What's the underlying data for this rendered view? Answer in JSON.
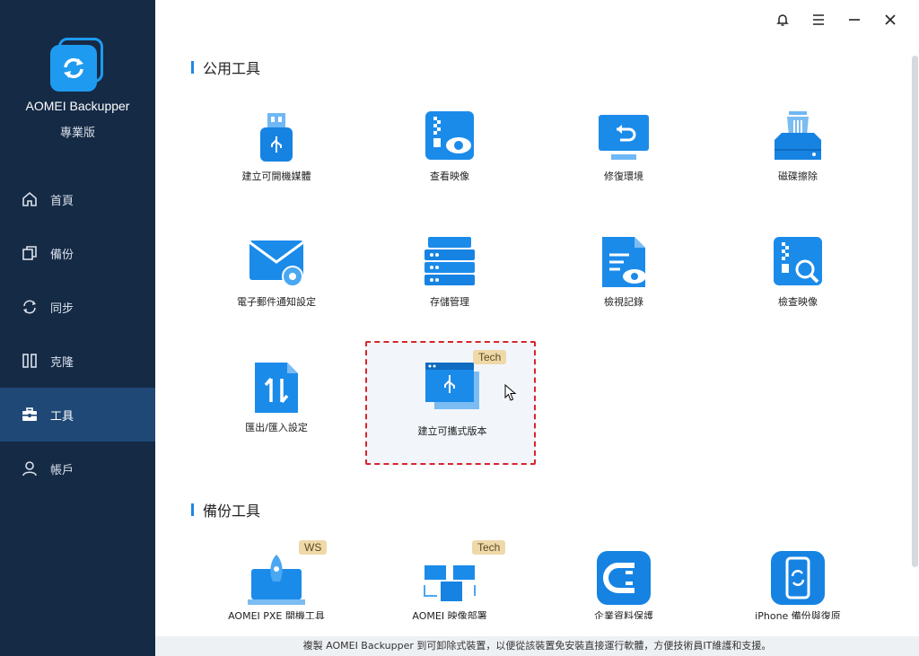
{
  "app": {
    "name": "AOMEI Backupper",
    "edition": "專業版"
  },
  "sidebar": {
    "items": [
      {
        "label": "首頁",
        "icon": "home-icon",
        "active": false
      },
      {
        "label": "備份",
        "icon": "copy-icon",
        "active": false
      },
      {
        "label": "同步",
        "icon": "sync-icon",
        "active": false
      },
      {
        "label": "克隆",
        "icon": "clone-icon",
        "active": false
      },
      {
        "label": "工具",
        "icon": "toolbox-icon",
        "active": true
      },
      {
        "label": "帳戶",
        "icon": "user-icon",
        "active": false
      }
    ]
  },
  "sections": {
    "utilities": {
      "title": "公用工具",
      "tools": [
        {
          "label": "建立可開機媒體",
          "icon": "usb-drive-icon"
        },
        {
          "label": "查看映像",
          "icon": "view-image-icon"
        },
        {
          "label": "修復環境",
          "icon": "recovery-environment-icon"
        },
        {
          "label": "磁碟擦除",
          "icon": "disk-wipe-icon"
        },
        {
          "label": "電子郵件通知設定",
          "icon": "email-settings-icon"
        },
        {
          "label": "存儲管理",
          "icon": "storage-management-icon"
        },
        {
          "label": "檢視記錄",
          "icon": "view-logs-icon"
        },
        {
          "label": "檢查映像",
          "icon": "check-image-icon"
        },
        {
          "label": "匯出/匯入設定",
          "icon": "export-import-icon"
        },
        {
          "label": "建立可攜式版本",
          "icon": "portable-version-icon",
          "badge": "Tech"
        }
      ]
    },
    "backup_tools": {
      "title": "備份工具",
      "tools": [
        {
          "label": "AOMEI PXE 開機工具",
          "icon": "pxe-boot-icon",
          "badge": "WS"
        },
        {
          "label": "AOMEI 映像部署",
          "icon": "image-deploy-icon",
          "badge": "Tech"
        },
        {
          "label": "企業資料保護",
          "icon": "centralized-backup-icon"
        },
        {
          "label": "iPhone 備份與復原",
          "icon": "iphone-backup-icon"
        }
      ]
    }
  },
  "footer": {
    "text": "複製 AOMEI Backupper 到可卸除式裝置，以便從該裝置免安裝直接運行軟體，方便技術員IT維護和支援。"
  },
  "colors": {
    "sidebar": "#152a45",
    "active": "#1f4876",
    "accent": "#1e88e5",
    "selection": "#d8252a"
  }
}
